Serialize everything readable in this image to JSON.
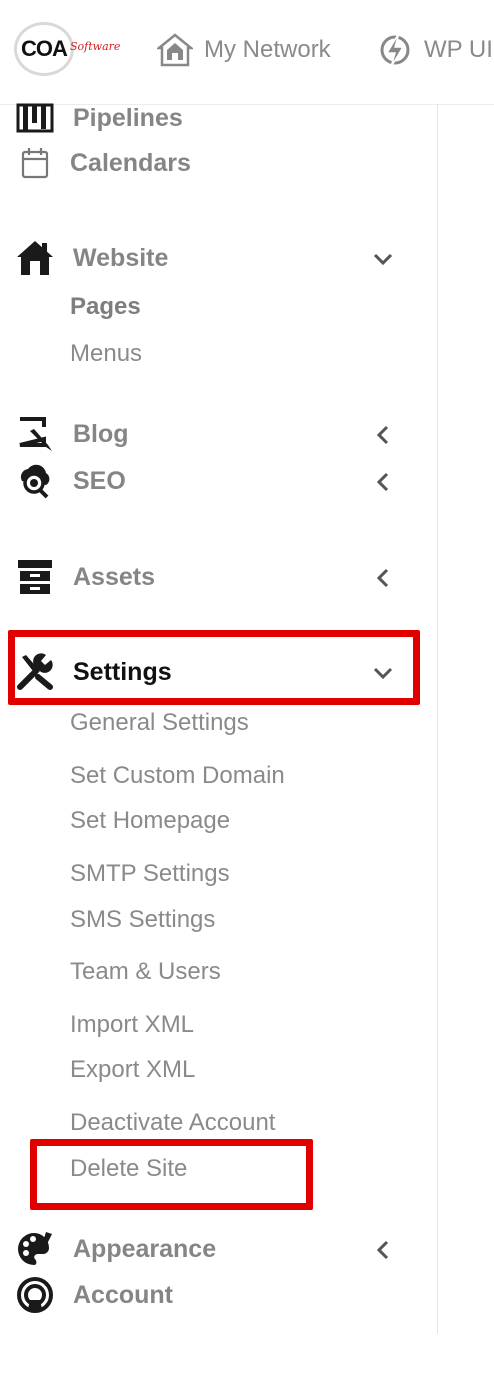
{
  "brand": {
    "logo_text": "COA",
    "logo_script": "Software"
  },
  "topnav": [
    {
      "label": "My Network",
      "icon": "network-icon"
    },
    {
      "label": "WP UI",
      "icon": "lightning-icon"
    }
  ],
  "sidebar": {
    "pipelines": "Pipelines",
    "calendars": "Calendars",
    "website": {
      "label": "Website",
      "children": [
        "Pages",
        "Menus"
      ]
    },
    "blog": "Blog",
    "seo": "SEO",
    "assets": "Assets",
    "settings": {
      "label": "Settings",
      "children": [
        "General Settings",
        "Set Custom Domain",
        "Set Homepage",
        "SMTP Settings",
        "SMS Settings",
        "Team & Users",
        "Import XML",
        "Export XML",
        "Deactivate Account",
        "Delete Site"
      ]
    },
    "appearance": "Appearance",
    "account": "Account"
  },
  "colors": {
    "highlight": "#e00000",
    "icon": "#1a1a1a",
    "text": "#858585"
  }
}
